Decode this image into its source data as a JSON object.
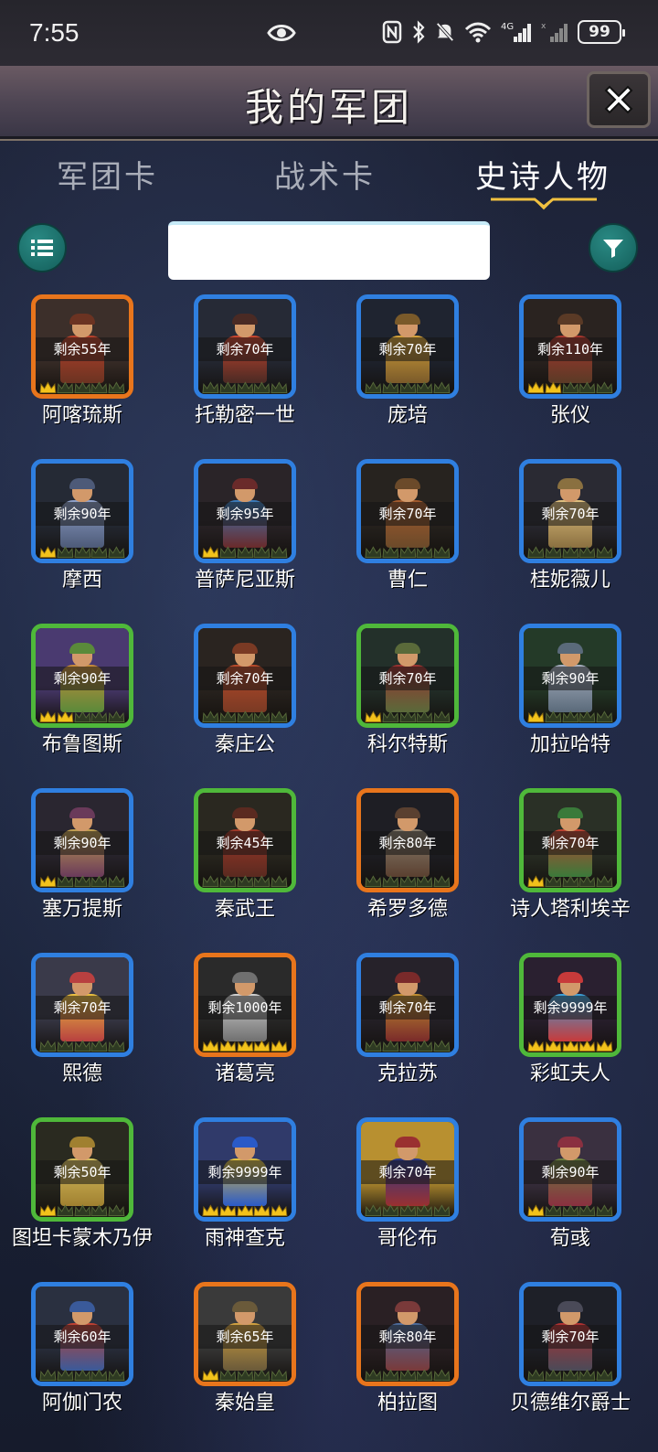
{
  "status_bar": {
    "time": "7:55",
    "battery": "99"
  },
  "header": {
    "title": "我的军团"
  },
  "tabs": [
    {
      "label": "军团卡"
    },
    {
      "label": "战术卡"
    },
    {
      "label": "史诗人物",
      "active": true
    }
  ],
  "search": {
    "value": "",
    "placeholder": ""
  },
  "colors": {
    "accent_teal": "#1f7a74",
    "border_blue": "#2f7fe0",
    "border_green": "#4fb83a",
    "border_orange": "#e8751c",
    "crown_gold": "#f2c21b"
  },
  "characters": [
    {
      "name": "阿喀琉斯",
      "remaining": "剩余55年",
      "rarity": "orange",
      "gold_crowns": 1,
      "total_crowns": 5
    },
    {
      "name": "托勒密一世",
      "remaining": "剩余70年",
      "rarity": "blue",
      "gold_crowns": 0,
      "total_crowns": 5
    },
    {
      "name": "庞培",
      "remaining": "剩余70年",
      "rarity": "blue",
      "gold_crowns": 0,
      "total_crowns": 5
    },
    {
      "name": "张仪",
      "remaining": "剩余110年",
      "rarity": "blue",
      "gold_crowns": 2,
      "total_crowns": 5
    },
    {
      "name": "摩西",
      "remaining": "剩余90年",
      "rarity": "blue",
      "gold_crowns": 1,
      "total_crowns": 5
    },
    {
      "name": "普萨尼亚斯",
      "remaining": "剩余95年",
      "rarity": "blue",
      "gold_crowns": 1,
      "total_crowns": 5
    },
    {
      "name": "曹仁",
      "remaining": "剩余70年",
      "rarity": "blue",
      "gold_crowns": 0,
      "total_crowns": 5
    },
    {
      "name": "桂妮薇儿",
      "remaining": "剩余70年",
      "rarity": "blue",
      "gold_crowns": 0,
      "total_crowns": 5
    },
    {
      "name": "布鲁图斯",
      "remaining": "剩余90年",
      "rarity": "green",
      "gold_crowns": 2,
      "total_crowns": 5
    },
    {
      "name": "秦庄公",
      "remaining": "剩余70年",
      "rarity": "blue",
      "gold_crowns": 0,
      "total_crowns": 5
    },
    {
      "name": "科尔特斯",
      "remaining": "剩余70年",
      "rarity": "green",
      "gold_crowns": 1,
      "total_crowns": 5
    },
    {
      "name": "加拉哈特",
      "remaining": "剩余90年",
      "rarity": "blue",
      "gold_crowns": 1,
      "total_crowns": 5
    },
    {
      "name": "塞万提斯",
      "remaining": "剩余90年",
      "rarity": "blue",
      "gold_crowns": 1,
      "total_crowns": 5
    },
    {
      "name": "秦武王",
      "remaining": "剩余45年",
      "rarity": "green",
      "gold_crowns": 0,
      "total_crowns": 5
    },
    {
      "name": "希罗多德",
      "remaining": "剩余80年",
      "rarity": "orange",
      "gold_crowns": 0,
      "total_crowns": 5
    },
    {
      "name": "诗人塔利埃辛",
      "remaining": "剩余70年",
      "rarity": "green",
      "gold_crowns": 1,
      "total_crowns": 5
    },
    {
      "name": "熙德",
      "remaining": "剩余70年",
      "rarity": "blue",
      "gold_crowns": 0,
      "total_crowns": 5
    },
    {
      "name": "诸葛亮",
      "remaining": "剩余1000年",
      "rarity": "orange",
      "gold_crowns": 5,
      "total_crowns": 5
    },
    {
      "name": "克拉苏",
      "remaining": "剩余70年",
      "rarity": "blue",
      "gold_crowns": 0,
      "total_crowns": 5
    },
    {
      "name": "彩虹夫人",
      "remaining": "剩余9999年",
      "rarity": "green",
      "gold_crowns": 5,
      "total_crowns": 5
    },
    {
      "name": "图坦卡蒙木乃伊",
      "remaining": "剩余50年",
      "rarity": "green",
      "gold_crowns": 1,
      "total_crowns": 5
    },
    {
      "name": "雨神查克",
      "remaining": "剩余9999年",
      "rarity": "blue",
      "gold_crowns": 5,
      "total_crowns": 5
    },
    {
      "name": "哥伦布",
      "remaining": "剩余70年",
      "rarity": "blue",
      "gold_crowns": 0,
      "total_crowns": 5
    },
    {
      "name": "荀彧",
      "remaining": "剩余90年",
      "rarity": "blue",
      "gold_crowns": 1,
      "total_crowns": 5
    },
    {
      "name": "阿伽门农",
      "remaining": "剩余60年",
      "rarity": "blue",
      "gold_crowns": 0,
      "total_crowns": 5
    },
    {
      "name": "秦始皇",
      "remaining": "剩余65年",
      "rarity": "orange",
      "gold_crowns": 1,
      "total_crowns": 5
    },
    {
      "name": "柏拉图",
      "remaining": "剩余80年",
      "rarity": "orange",
      "gold_crowns": 0,
      "total_crowns": 5
    },
    {
      "name": "贝德维尔爵士",
      "remaining": "剩余70年",
      "rarity": "blue",
      "gold_crowns": 0,
      "total_crowns": 5
    }
  ]
}
